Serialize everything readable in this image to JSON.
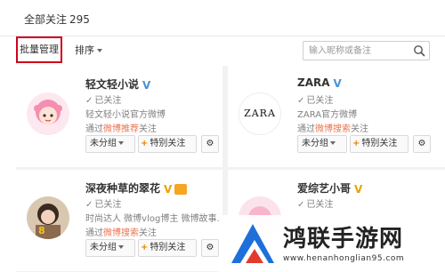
{
  "header": {
    "title": "全部关注",
    "count": "295"
  },
  "toolbar": {
    "manage_label": "批量管理",
    "sort_label": "排序",
    "search_placeholder": "输入昵称或备注"
  },
  "cards": [
    {
      "name": "轻文轻小说",
      "badge": "V",
      "badge_color": "#4a90d9",
      "followed": "已关注",
      "desc": "轻文轻小说官方微博",
      "via_prefix": "通过",
      "via_source": "微博推荐",
      "via_suffix": "关注",
      "group_label": "未分组",
      "special_label": "特别关注"
    },
    {
      "name": "ZARA",
      "badge": "V",
      "badge_color": "#4a90d9",
      "followed": "已关注",
      "desc": "ZARA官方微博",
      "via_prefix": "通过",
      "via_source": "微博搜索",
      "via_suffix": "关注",
      "group_label": "未分组",
      "special_label": "特别关注",
      "avatar_text": "ZARA"
    },
    {
      "name": "深夜种草的翠花",
      "badge": "V",
      "badge_color": "#e8a200",
      "followed": "已关注",
      "desc": "时尚达人 微博vlog博主 微博故事...",
      "via_prefix": "通过",
      "via_source": "微博搜索",
      "via_suffix": "关注",
      "group_label": "未分组",
      "special_label": "特别关注"
    },
    {
      "name": "爱综艺小哥",
      "badge": "V",
      "badge_color": "#e8a200",
      "followed": "已关注",
      "desc": "",
      "via_prefix": "",
      "via_source": "",
      "via_suffix": "",
      "group_label": "",
      "special_label": ""
    }
  ],
  "icons": {
    "check": "✓",
    "plus": "+",
    "gear": "⚙"
  },
  "colors": {
    "accent_orange": "#eb7350",
    "highlight_box": "#d0021b",
    "verify_blue": "#4a90d9",
    "verify_gold": "#e8a200"
  },
  "watermark": {
    "text": "鸿联手游网",
    "url": "www.henanhonglian95.com"
  }
}
